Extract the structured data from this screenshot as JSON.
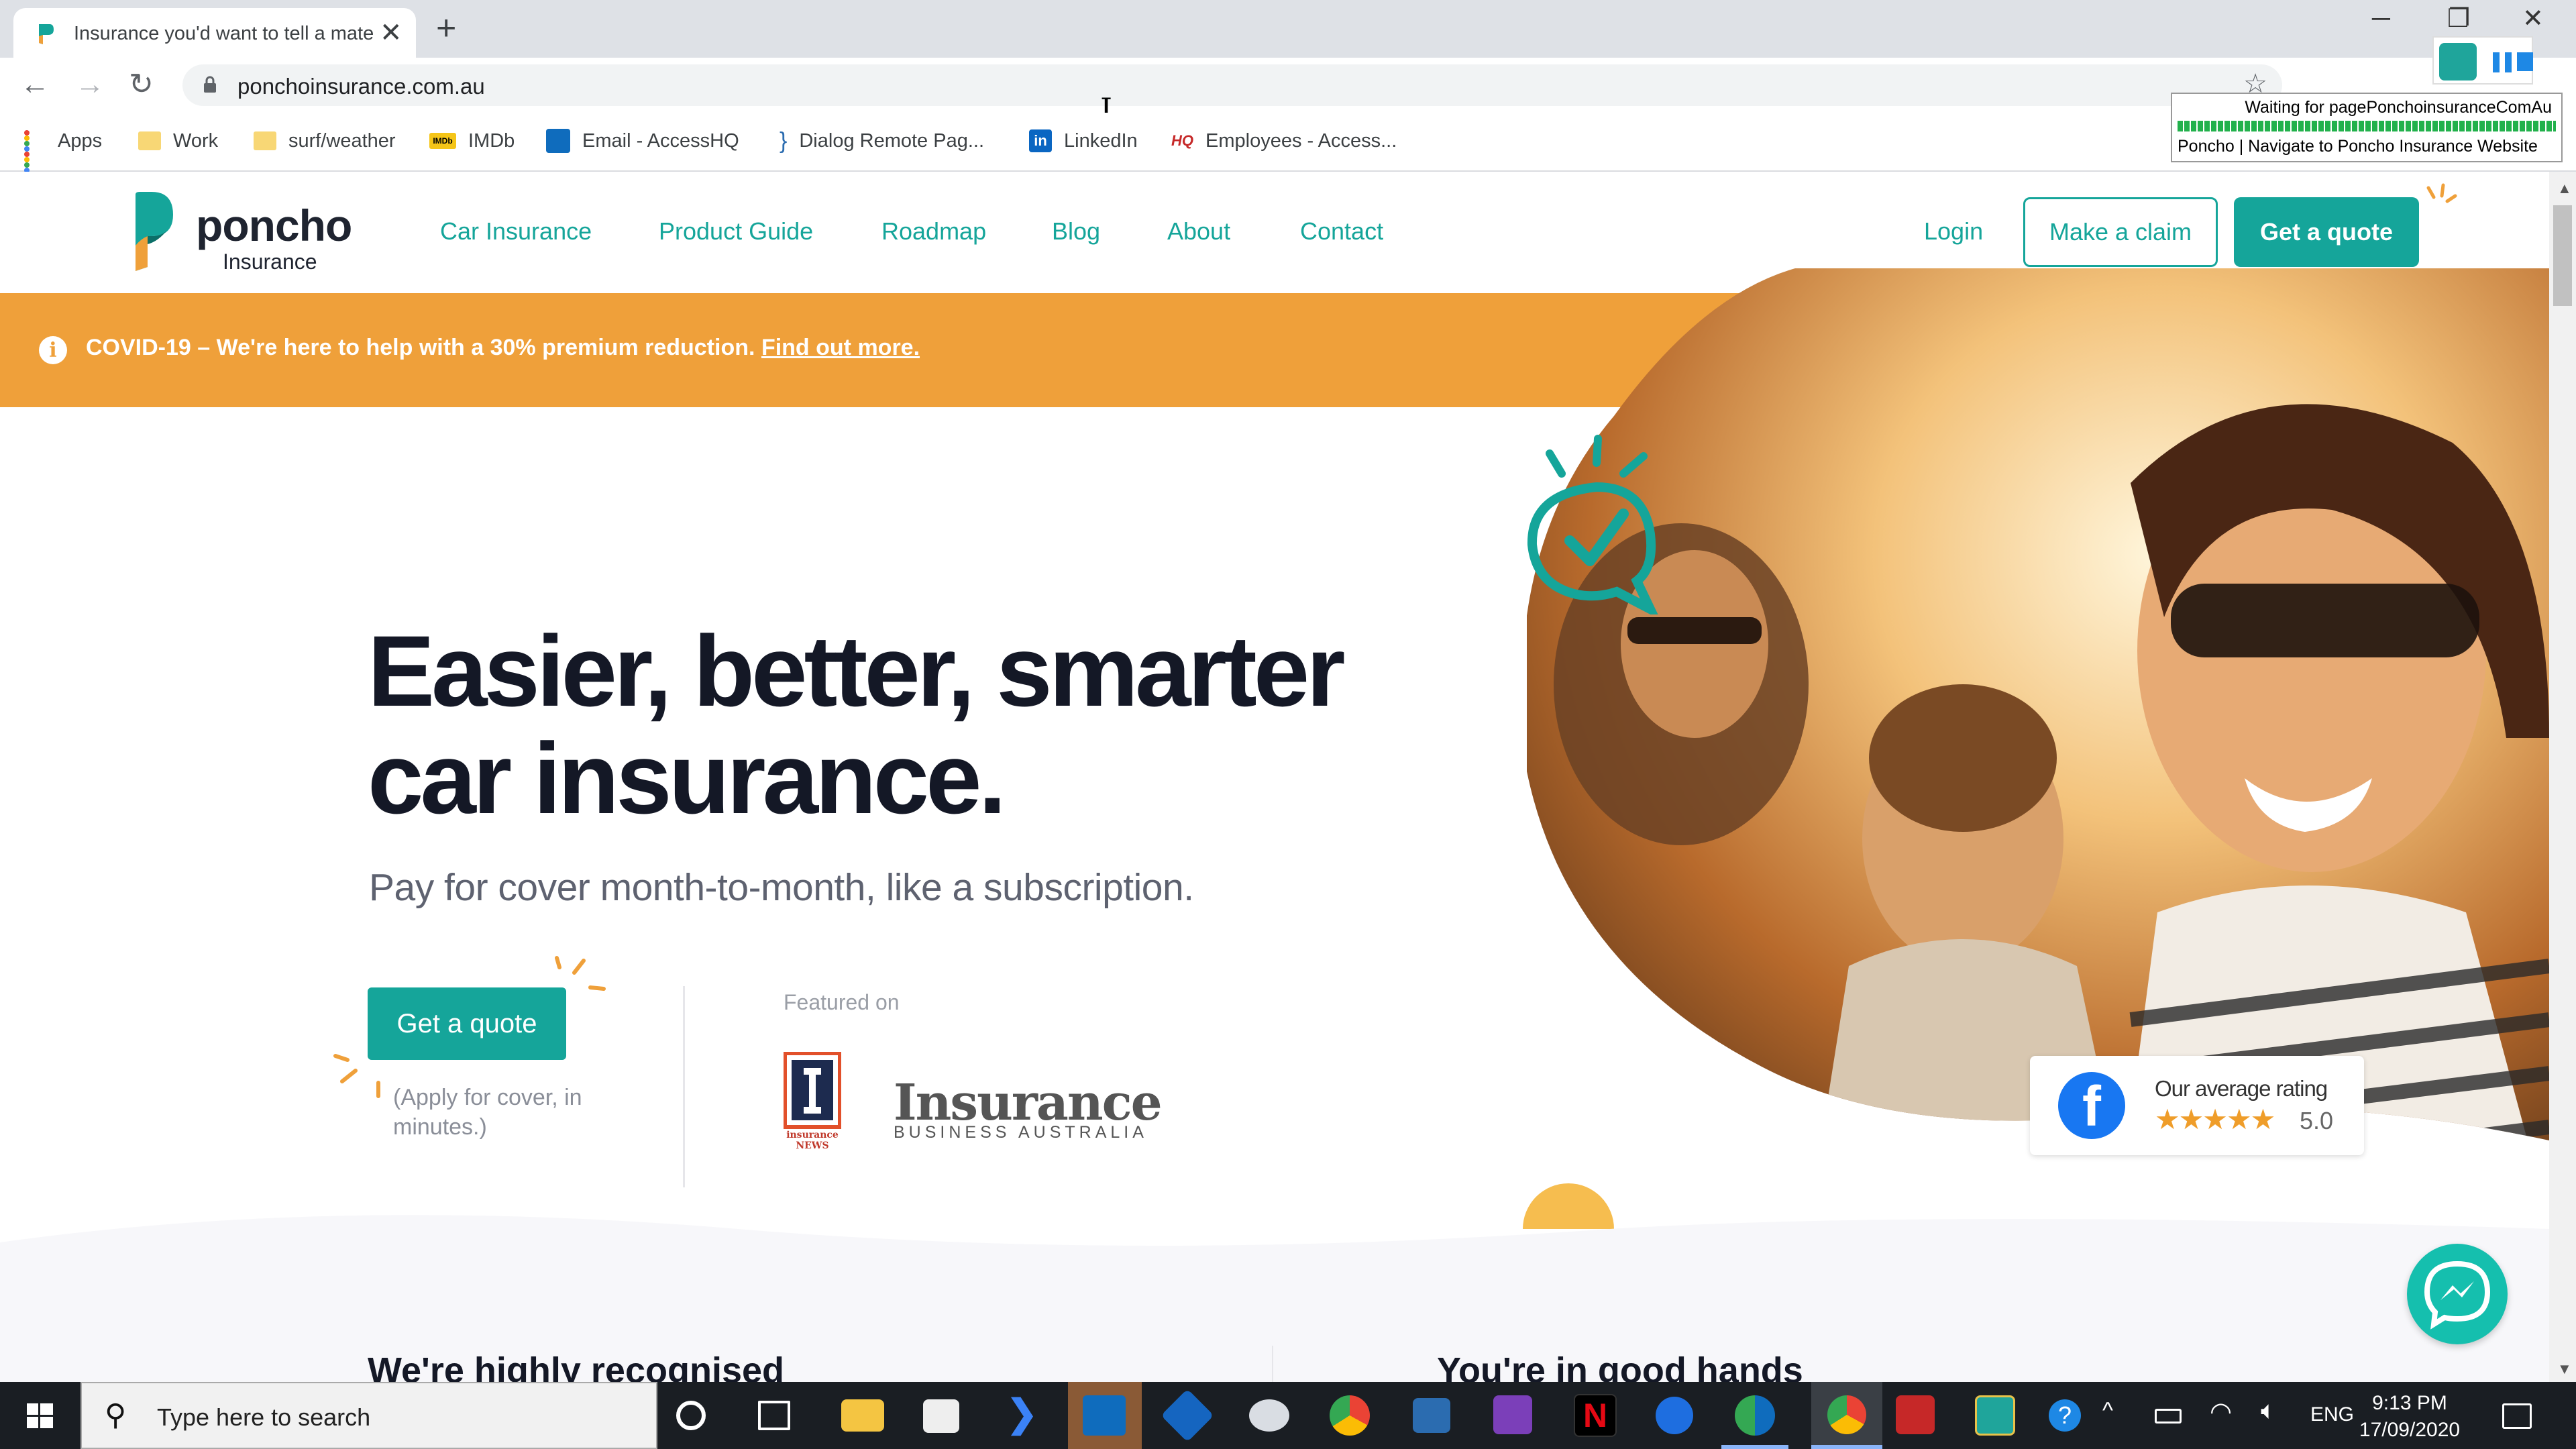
{
  "browser": {
    "tab_title": "Insurance you'd want to tell a mate about",
    "close_tab": "✕",
    "new_tab": "+",
    "url": "ponchoinsurance.com.au",
    "bookmarks": [
      {
        "label": "Apps",
        "icon": "apps-grid-icon"
      },
      {
        "label": "Work",
        "icon": "folder-icon"
      },
      {
        "label": "surf/weather",
        "icon": "folder-icon"
      },
      {
        "label": "IMDb",
        "icon": "imdb-icon"
      },
      {
        "label": "Email - AccessHQ",
        "icon": "outlook-icon"
      },
      {
        "label": "Dialog Remote Pag...",
        "icon": "bracket-icon"
      },
      {
        "label": "LinkedIn",
        "icon": "linkedin-icon"
      },
      {
        "label": "Employees - Access...",
        "icon": "hq-icon"
      }
    ],
    "overlay": {
      "waiting": "Waiting for pagePonchoinsuranceComAu",
      "step": "Poncho | Navigate to Poncho Insurance Website"
    }
  },
  "header": {
    "logo_name": "poncho",
    "logo_sub": "Insurance",
    "nav": [
      "Car Insurance",
      "Product Guide",
      "Roadmap",
      "Blog",
      "About",
      "Contact"
    ],
    "login": "Login",
    "claim": "Make a claim",
    "quote": "Get a quote"
  },
  "banner": {
    "text": "COVID-19 – We're here to help with a 30% premium reduction.",
    "link": "Find out more."
  },
  "hero": {
    "headline_1": "Easier, better, smarter",
    "headline_2": "car insurance.",
    "subtitle": "Pay for cover month-to-month, like a subscription.",
    "cta": "Get a quote",
    "cta_note": "(Apply for cover, in minutes.)",
    "featured_label": "Featured on",
    "pub1_text": "insurance NEWS",
    "pub2_big": "Insurance",
    "pub2_small": "BUSINESS AUSTRALIA"
  },
  "rating": {
    "label": "Our average rating",
    "stars": "★★★★★",
    "value": "5.0"
  },
  "sections": {
    "left": "We're highly recognised",
    "right": "You're in good hands"
  },
  "taskbar": {
    "search_placeholder": "Type here to search",
    "lang": "ENG",
    "time": "9:13 PM",
    "date": "17/09/2020"
  },
  "colors": {
    "brand": "#15a59a",
    "banner": "#efa03a",
    "ink": "#141826"
  }
}
